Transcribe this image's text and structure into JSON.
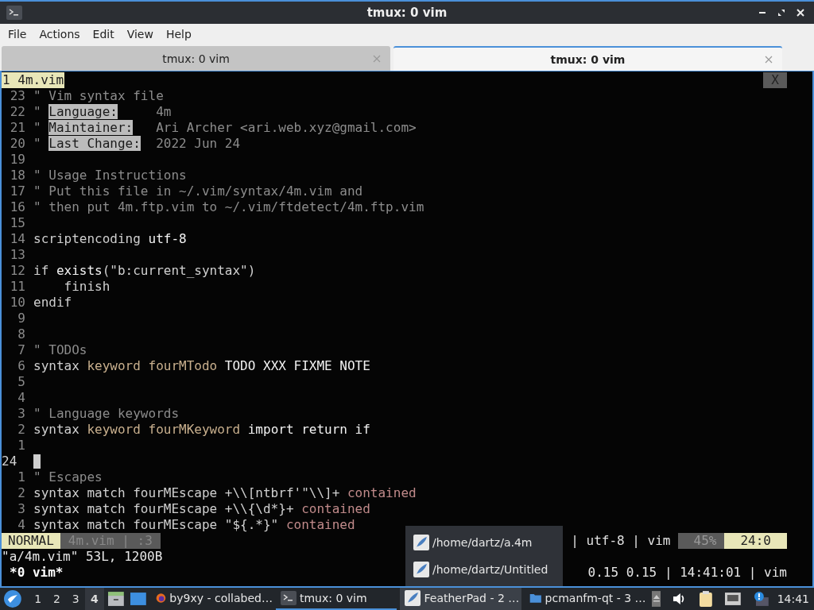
{
  "window": {
    "title": "tmux: 0 vim"
  },
  "menu": [
    "File",
    "Actions",
    "Edit",
    "View",
    "Help"
  ],
  "tabs": [
    {
      "label": "tmux: 0 vim",
      "selected": false
    },
    {
      "label": "tmux: 0 vim",
      "selected": true
    }
  ],
  "tmux_tabline": {
    "window": "1 4m.vim",
    "close": "X"
  },
  "lines": [
    {
      "number": "23",
      "segments": [
        {
          "kind": "comment",
          "text": "\" Vim syntax file"
        }
      ]
    },
    {
      "number": "22",
      "segments": [
        {
          "kind": "comment",
          "text": "\" "
        },
        {
          "kind": "label",
          "text": "Language:"
        },
        {
          "kind": "comment",
          "text": "     4m"
        }
      ]
    },
    {
      "number": "21",
      "segments": [
        {
          "kind": "comment",
          "text": "\" "
        },
        {
          "kind": "label",
          "text": "Maintainer:"
        },
        {
          "kind": "comment",
          "text": "   Ari Archer <ari.web.xyz@gmail.com>"
        }
      ]
    },
    {
      "number": "20",
      "segments": [
        {
          "kind": "comment",
          "text": "\" "
        },
        {
          "kind": "label",
          "text": "Last Change:"
        },
        {
          "kind": "comment",
          "text": "  2022 Jun 24"
        }
      ]
    },
    {
      "number": "19"
    },
    {
      "number": "18",
      "segments": [
        {
          "kind": "comment",
          "text": "\" Usage Instructions"
        }
      ]
    },
    {
      "number": "17",
      "segments": [
        {
          "kind": "comment",
          "text": "\" Put this file in ~/.vim/syntax/4m.vim and"
        }
      ]
    },
    {
      "number": "16",
      "segments": [
        {
          "kind": "comment",
          "text": "\" then put 4m.ftp.vim to ~/.vim/ftdetect/4m.ftp.vim"
        }
      ]
    },
    {
      "number": "15"
    },
    {
      "number": "14",
      "segments": [
        {
          "kind": "plain",
          "text": "scriptencoding "
        },
        {
          "kind": "bright",
          "text": "utf-8"
        }
      ]
    },
    {
      "number": "13"
    },
    {
      "number": "12",
      "segments": [
        {
          "kind": "plain",
          "text": "if "
        },
        {
          "kind": "bright",
          "text": "exists"
        },
        {
          "kind": "plain",
          "text": "(\"b:current_syntax\")"
        }
      ]
    },
    {
      "number": "11",
      "segments": [
        {
          "kind": "plain",
          "text": "    finish"
        }
      ]
    },
    {
      "number": "10",
      "segments": [
        {
          "kind": "plain",
          "text": "endif"
        }
      ]
    },
    {
      "number": "9"
    },
    {
      "number": "8"
    },
    {
      "number": "7",
      "segments": [
        {
          "kind": "comment",
          "text": "\" TODOs"
        }
      ]
    },
    {
      "number": "6",
      "segments": [
        {
          "kind": "plain",
          "text": "syntax "
        },
        {
          "kind": "keyword",
          "text": "keyword fourMTodo"
        },
        {
          "kind": "bright",
          "text": " TODO XXX FIXME NOTE"
        }
      ]
    },
    {
      "number": "5"
    },
    {
      "number": "4"
    },
    {
      "number": "3",
      "segments": [
        {
          "kind": "comment",
          "text": "\" Language keywords"
        }
      ]
    },
    {
      "number": "2",
      "segments": [
        {
          "kind": "plain",
          "text": "syntax "
        },
        {
          "kind": "keyword",
          "text": "keyword fourMKeyword"
        },
        {
          "kind": "bright",
          "text": " import return if"
        }
      ]
    },
    {
      "number": "1"
    },
    {
      "number": "24",
      "current": true
    },
    {
      "number": "1",
      "segments": [
        {
          "kind": "comment",
          "text": "\" Escapes"
        }
      ]
    },
    {
      "number": "2",
      "segments": [
        {
          "kind": "plain",
          "text": "syntax match fourMEscape +\\\\[ntbrf'\"\\\\]+ "
        },
        {
          "kind": "contained",
          "text": "contained"
        }
      ]
    },
    {
      "number": "3",
      "segments": [
        {
          "kind": "plain",
          "text": "syntax match fourMEscape +\\\\{\\d*}+ "
        },
        {
          "kind": "contained",
          "text": "contained"
        }
      ]
    },
    {
      "number": "4",
      "segments": [
        {
          "kind": "plain",
          "text": "syntax match fourMEscape \"${.*}\" "
        },
        {
          "kind": "contained",
          "text": "contained"
        }
      ]
    }
  ],
  "statusline": {
    "mode": "NORMAL",
    "file": "4m.vim | :3",
    "encoding": "| utf-8 | vim",
    "percent": "45%",
    "position": "24:0"
  },
  "message": "\"a/4m.vim\" 53L, 1200B",
  "tmux_status": {
    "window": "*0 vim*",
    "right": "0.15 0.15 | 14:41:01 | vim"
  },
  "popup": {
    "items": [
      "/home/dartz/a.4m",
      "/home/dartz/Untitled"
    ]
  },
  "taskbar": {
    "workspaces": [
      {
        "label": "1",
        "selected": false
      },
      {
        "label": "2",
        "selected": false
      },
      {
        "label": "3",
        "selected": false
      },
      {
        "label": "4",
        "selected": true
      }
    ],
    "tasks": [
      {
        "kind": "browser",
        "label": "by9xy - collabed…",
        "active": false,
        "highlighted": false
      },
      {
        "kind": "terminal",
        "label": "tmux: 0 vim",
        "active": true,
        "highlighted": false
      },
      {
        "kind": "editor",
        "label": "FeatherPad - 2 …",
        "active": false,
        "highlighted": true
      },
      {
        "kind": "folder",
        "label": "pcmanfm-qt - 3 …",
        "active": false,
        "highlighted": false
      }
    ],
    "clock": "14:41"
  }
}
